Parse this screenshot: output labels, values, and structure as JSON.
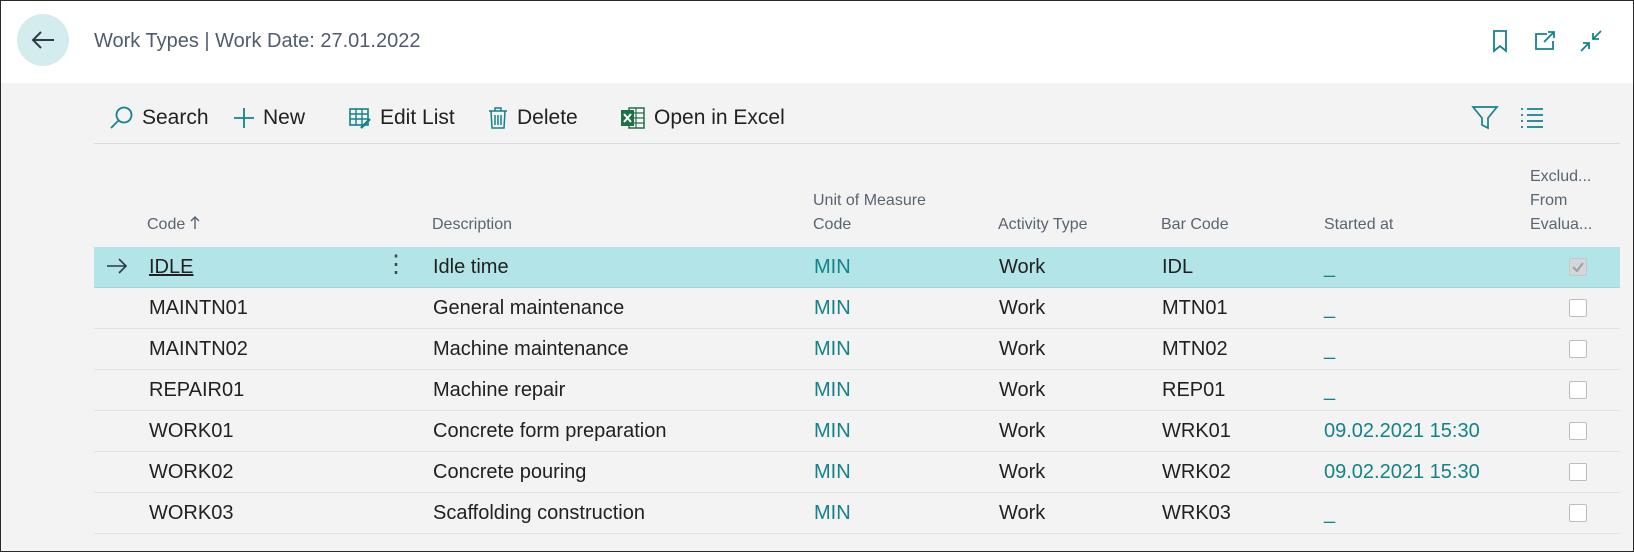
{
  "header": {
    "title": "Work Types | Work Date: 27.01.2022"
  },
  "actions": {
    "search": "Search",
    "new": "New",
    "edit_list": "Edit List",
    "delete": "Delete",
    "open_excel": "Open in Excel"
  },
  "columns": {
    "code": "Code",
    "description": "Description",
    "uom_line1": "Unit of Measure",
    "uom_line2": "Code",
    "activity_type": "Activity Type",
    "bar_code": "Bar Code",
    "started_at": "Started at",
    "excl_line1": "Exclud...",
    "excl_line2": "From",
    "excl_line3": "Evalua..."
  },
  "rows": [
    {
      "code": "IDLE",
      "description": "Idle time",
      "uom": "MIN",
      "activity": "Work",
      "bar_code": "IDL",
      "started_at": "_",
      "excluded": true
    },
    {
      "code": "MAINTN01",
      "description": "General maintenance",
      "uom": "MIN",
      "activity": "Work",
      "bar_code": "MTN01",
      "started_at": "_",
      "excluded": false
    },
    {
      "code": "MAINTN02",
      "description": "Machine maintenance",
      "uom": "MIN",
      "activity": "Work",
      "bar_code": "MTN02",
      "started_at": "_",
      "excluded": false
    },
    {
      "code": "REPAIR01",
      "description": "Machine repair",
      "uom": "MIN",
      "activity": "Work",
      "bar_code": "REP01",
      "started_at": "_",
      "excluded": false
    },
    {
      "code": "WORK01",
      "description": "Concrete form preparation",
      "uom": "MIN",
      "activity": "Work",
      "bar_code": "WRK01",
      "started_at": "09.02.2021 15:30",
      "excluded": false
    },
    {
      "code": "WORK02",
      "description": "Concrete pouring",
      "uom": "MIN",
      "activity": "Work",
      "bar_code": "WRK02",
      "started_at": "09.02.2021 15:30",
      "excluded": false
    },
    {
      "code": "WORK03",
      "description": "Scaffolding construction",
      "uom": "MIN",
      "activity": "Work",
      "bar_code": "WRK03",
      "started_at": "_",
      "excluded": false
    }
  ],
  "colors": {
    "accent": "#14828a",
    "selected_row": "#b3e5e8",
    "back_button": "#d4ecee"
  }
}
